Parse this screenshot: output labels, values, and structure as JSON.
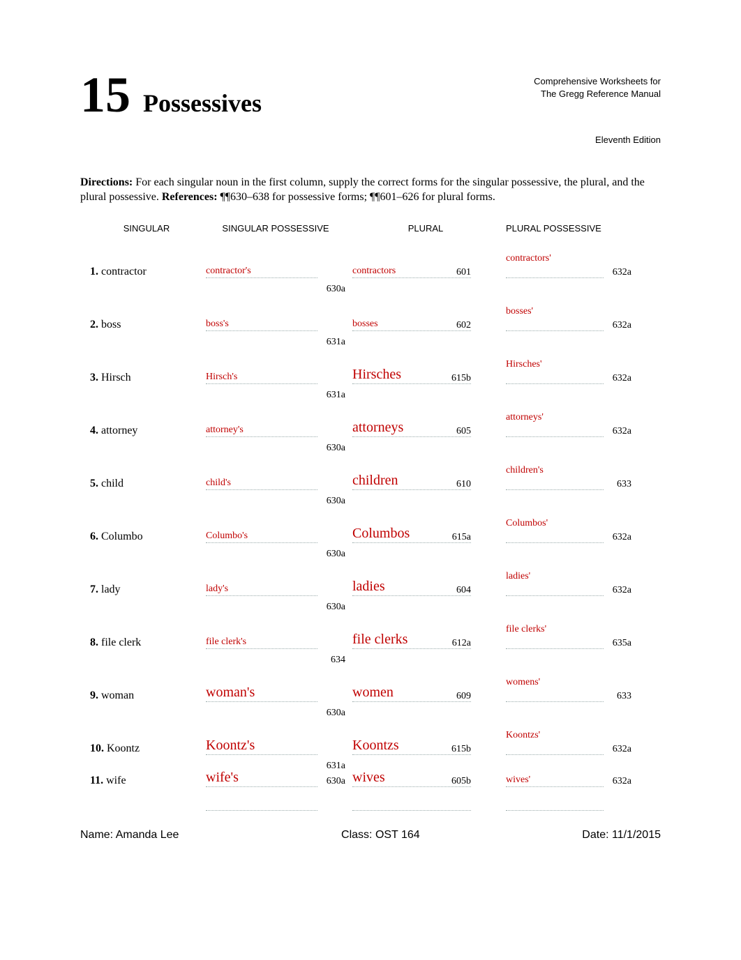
{
  "header": {
    "chapter_number": "15",
    "chapter_title": "Possessives",
    "source_line1": "Comprehensive Worksheets for",
    "source_line2": "The Gregg Reference Manual",
    "source_edition": "Eleventh Edition"
  },
  "directions": {
    "label": "Directions:",
    "body_a": "For each singular noun in the first column, supply the correct forms for the singular possessive, the plural, and the plural possessive.",
    "refs_label": "References:",
    "refs_body": "¶¶630–638 for possessive forms; ¶¶601–626 for plural forms."
  },
  "columns": {
    "c1": "SINGULAR",
    "c2": "SINGULAR POSSESSIVE",
    "c3": "PLURAL",
    "c4": "PLURAL POSSESSIVE"
  },
  "rows": [
    {
      "n": "1.",
      "singular": "contractor",
      "sp": "contractor's",
      "sp_style": "small",
      "sp_ref": "630a",
      "plural": "contractors",
      "plural_style": "small",
      "plural_ref": "601",
      "pp": "contractors'",
      "pp_ref": "632a"
    },
    {
      "n": "2.",
      "singular": "boss",
      "sp": "boss's",
      "sp_style": "small",
      "sp_ref": "631a",
      "plural": "bosses",
      "plural_style": "small",
      "plural_ref": "602",
      "pp": "bosses'",
      "pp_ref": "632a"
    },
    {
      "n": "3.",
      "singular": "Hirsch",
      "sp": "Hirsch's",
      "sp_style": "small",
      "sp_ref": "631a",
      "plural": "Hirsches",
      "plural_style": "large",
      "plural_ref": "615b",
      "pp": "Hirsches'",
      "pp_ref": "632a"
    },
    {
      "n": "4.",
      "singular": "attorney",
      "sp": "attorney's",
      "sp_style": "small",
      "sp_ref": "630a",
      "plural": "attorneys",
      "plural_style": "large",
      "plural_ref": "605",
      "pp": "attorneys'",
      "pp_ref": "632a"
    },
    {
      "n": "5.",
      "singular": "child",
      "sp": "child's",
      "sp_style": "small",
      "sp_ref": "630a",
      "plural": "children",
      "plural_style": "large",
      "plural_ref": "610",
      "pp": "children's",
      "pp_ref": "633"
    },
    {
      "n": "6.",
      "singular": "Columbo",
      "sp": "Columbo's",
      "sp_style": "small",
      "sp_ref": "630a",
      "plural": "Columbos",
      "plural_style": "large",
      "plural_ref": "615a",
      "pp": "Columbos'",
      "pp_ref": "632a"
    },
    {
      "n": "7.",
      "singular": "lady",
      "sp": "lady's",
      "sp_style": "small",
      "sp_ref": "630a",
      "plural": "ladies",
      "plural_style": "large",
      "plural_ref": "604",
      "pp": "ladies'",
      "pp_ref": "632a"
    },
    {
      "n": "8.",
      "singular": "file clerk",
      "sp": "file clerk's",
      "sp_style": "small",
      "sp_ref": "634",
      "plural": "file clerks",
      "plural_style": "large",
      "plural_ref": "612a",
      "pp": "file clerks'",
      "pp_ref": "635a"
    },
    {
      "n": "9.",
      "singular": "woman",
      "sp": "woman's",
      "sp_style": "large",
      "sp_ref": "630a",
      "plural": "women",
      "plural_style": "large",
      "plural_ref": "609",
      "pp": "womens'",
      "pp_ref": "633"
    },
    {
      "n": "10.",
      "singular": "Koontz",
      "sp": "Koontz's",
      "sp_style": "large",
      "sp_ref": "631a",
      "plural": "Koontzs",
      "plural_style": "large",
      "plural_ref": "615b",
      "pp": "Koontzs'",
      "pp_ref": "632a"
    },
    {
      "n": "11.",
      "singular": "wife",
      "sp": "wife's",
      "sp_style": "large",
      "sp_ref": "630a",
      "plural": "wives",
      "plural_style": "large",
      "plural_ref": "605b",
      "pp": "wives'",
      "pp_ref": "632a"
    }
  ],
  "footer": {
    "name_label": "Name:",
    "name_value": "Amanda Lee",
    "class_label": "Class:",
    "class_value": "OST 164",
    "date_label": "Date:",
    "date_value": "11/1/2015"
  }
}
